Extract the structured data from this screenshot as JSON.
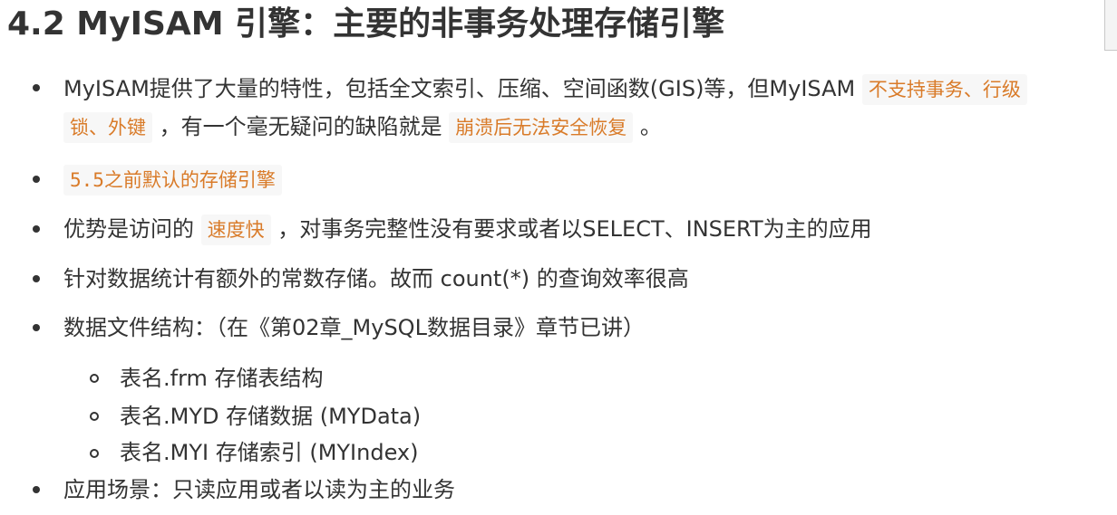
{
  "heading": "4.2 MyISAM 引擎：主要的非事务处理存储引擎",
  "items": [
    {
      "text1": "MyISAM提供了大量的特性，包括全文索引、压缩、空间函数(GIS)等，但MyISAM",
      "code1a": "不支持事务、行级",
      "code1b": "锁、外键",
      "text2": "，有一个毫无疑问的缺陷就是",
      "code2": "崩溃后无法安全恢复",
      "text3": "。"
    },
    {
      "code1": "5.5之前默认的存储引擎"
    },
    {
      "text1": "优势是访问的",
      "code1": "速度快",
      "text2": "，对事务完整性没有要求或者以SELECT、INSERT为主的应用"
    },
    {
      "text1": "针对数据统计有额外的常数存储。故而 count(*) 的查询效率很高"
    },
    {
      "text1": "数据文件结构：（在《第02章_MySQL数据目录》章节已讲）",
      "sub_items": [
        "表名.frm 存储表结构",
        "表名.MYD 存储数据 (MYData)",
        "表名.MYI 存储索引 (MYIndex)"
      ]
    },
    {
      "text1": "应用场景：只读应用或者以读为主的业务"
    }
  ]
}
